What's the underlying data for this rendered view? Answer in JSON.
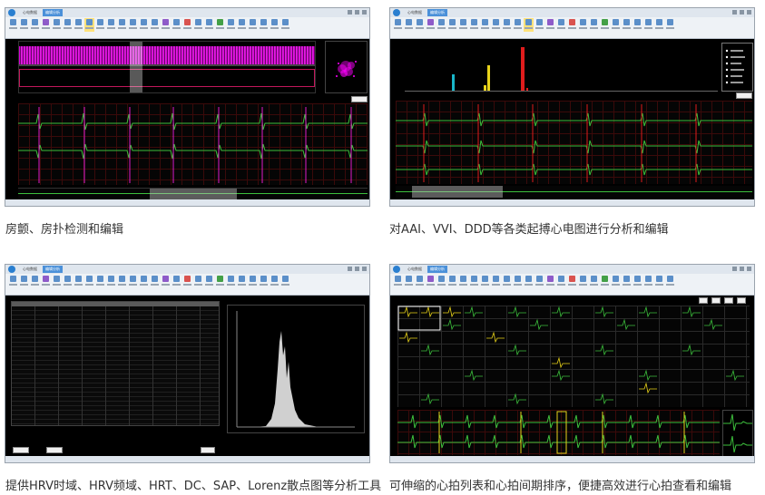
{
  "captions": [
    "房颤、房扑检测和编辑",
    "对AAI、VVI、DDD等各类起搏心电图进行分析和编辑",
    "提供HRV时域、HRV频域、HRT、DC、SAP、Lorenz散点图等分析工具",
    "可伸缩的心拍列表和心拍间期排序，便捷高效进行心拍查看和编辑"
  ],
  "window_tabs": [
    "心电数据",
    "编辑分析"
  ],
  "icons": {
    "app_logo": "app-logo-icon",
    "toolbar_button": "toolbar-tool-icon",
    "window_controls": [
      "minimize-icon",
      "maximize-icon",
      "close-icon"
    ]
  },
  "colors": {
    "magenta_trend": "#ff00ff",
    "ecg_green": "#3cbf3c",
    "ecg_red": "#d42a2a",
    "histogram_gray": "#d0d0d0",
    "pacing_cyan": "#19b6c9",
    "pacing_yellow": "#e8d31a",
    "pacing_red": "#e01c1c",
    "highlight_yellow": "#ffe27a"
  }
}
